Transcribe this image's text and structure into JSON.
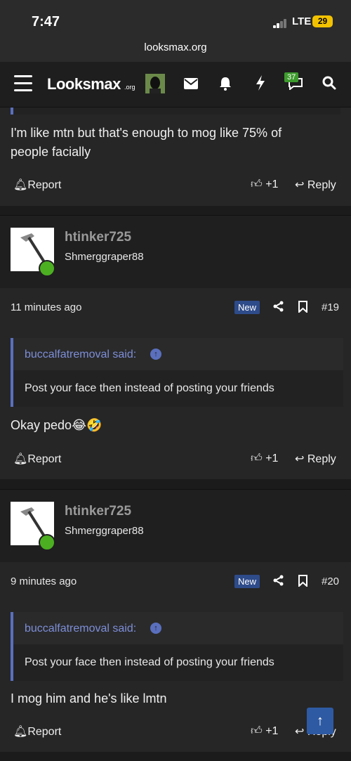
{
  "status_bar": {
    "time": "7:47",
    "network": "LTE",
    "battery": "29"
  },
  "browser": {
    "url": "looksmax.org"
  },
  "nav": {
    "logo_main": "Looksmax",
    "logo_suffix": ".org",
    "notifications_count": "37"
  },
  "posts": [
    {
      "text_lines": [
        "I'm like mtn but that's enough to mog like 75% of",
        "people facially"
      ],
      "report_label": "Report",
      "likes": "+1",
      "reply_label": "Reply"
    },
    {
      "username": "htinker725",
      "user_title": "Shmerggraper88",
      "time": "11 minutes ago",
      "new_label": "New",
      "post_number": "#19",
      "quote_author": "buccalfatremoval said:",
      "quote_text": "Post your face then instead of posting your friends",
      "text": "Okay pedo",
      "emoji": "😂🤣",
      "report_label": "Report",
      "likes": "+1",
      "reply_label": "Reply"
    },
    {
      "username": "htinker725",
      "user_title": "Shmerggraper88",
      "time": "9 minutes ago",
      "new_label": "New",
      "post_number": "#20",
      "quote_author": "buccalfatremoval said:",
      "quote_text": "Post your face then instead of posting your friends",
      "text": "I mog him and he's like lmtn",
      "report_label": "Report",
      "likes": "+1",
      "reply_label": "Reply"
    }
  ],
  "icons": [
    "hamburger-icon",
    "mail-icon",
    "bell-icon",
    "bolt-icon",
    "chat-icon",
    "search-icon",
    "share-icon",
    "bookmark-icon",
    "thumbs-up-icon",
    "reply-arrow-icon",
    "scroll-top-icon"
  ],
  "colors": {
    "accent": "#5a6fbd",
    "online": "#4caf22",
    "new_badge": "#2e4b8a"
  }
}
